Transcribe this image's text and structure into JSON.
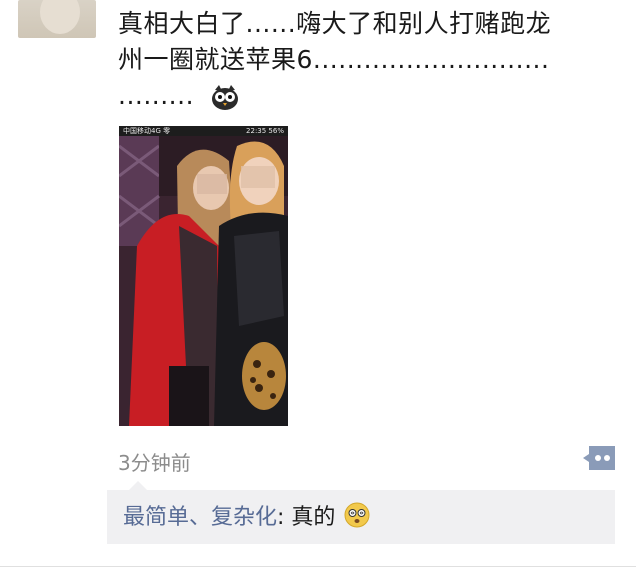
{
  "post": {
    "line1": "真相大白了......嗨大了和别人打赌跑龙",
    "line2": "州一圈就送苹果6............................",
    "line3": ".........",
    "emoji": "owl-emoji-icon"
  },
  "photo": {
    "status_left": "中国移动4G 零",
    "status_right": "22:35 56%"
  },
  "meta": {
    "timestamp": "3分钟前"
  },
  "comment": {
    "author": "最简单、复杂化",
    "colon": ": ",
    "text": "真的",
    "emoji": "dizzy-face-emoji-icon"
  },
  "colors": {
    "link": "#576b95",
    "timestamp": "#8c8c8c",
    "comment_bg": "#f0f0f2"
  }
}
